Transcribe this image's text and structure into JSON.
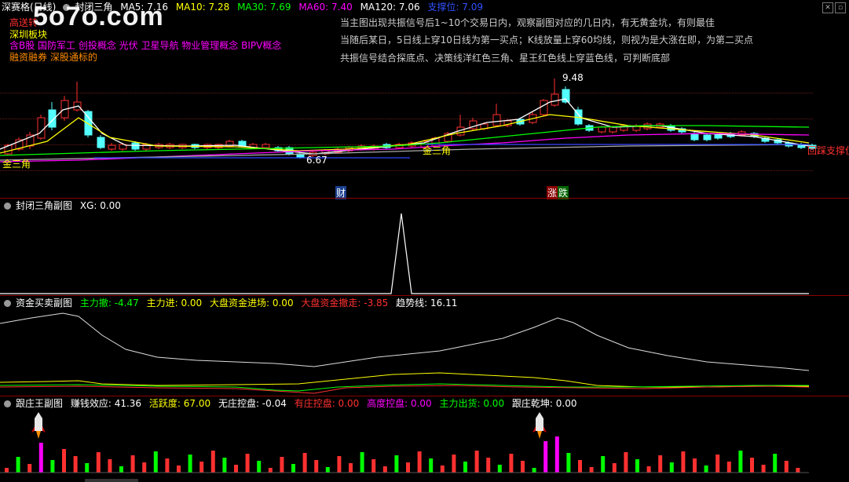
{
  "main": {
    "stock_name": "深赛格(日线)",
    "formula": "封闭三角",
    "indicators": [
      {
        "label": "MA5: 7.16",
        "color": "#ffffff"
      },
      {
        "label": "MA10: 7.28",
        "color": "#ffff00"
      },
      {
        "label": "MA30: 7.69",
        "color": "#00ff00"
      },
      {
        "label": "MA60: 7.40",
        "color": "#ff00ff"
      },
      {
        "label": "MA120: 7.06",
        "color": "#ffffff"
      },
      {
        "label": "支撑位: 7.09",
        "color": "#3050ff"
      }
    ],
    "concepts": [
      {
        "text": "高送转",
        "color": "#ff3030"
      },
      {
        "text": "深圳板块",
        "color": "#ffff00"
      },
      {
        "text": "含B股 国防军工 创投概念 光伏 卫星导航 物业管理概念 BIPV概念",
        "color": "#ff00ff"
      },
      {
        "text": "融资融券 深股通标的",
        "color": "#ff8c00"
      }
    ],
    "notes": [
      "当主图出现共振信号后1~10个交易日内，观察副图对应的几日内，有无黄金坑，有则最佳",
      "当随后某日，5日线上穿10日线为第一买点；K线放量上穿60均线，则视为是大涨在即，为第二买点",
      "共振信号结合探底点、决策线洋红色三角、星王红色线上穿蓝色线，可判断底部"
    ],
    "high_label": "9.48",
    "low_label": "6.67",
    "jin_san_jiao_1": "金三角",
    "jin_san_jiao_2": "金三角",
    "support_tag": "回踩支撑位",
    "cai_tag": "财",
    "zhang_tag": "涨",
    "die_tag": "跌",
    "watermark": "5o7o.com"
  },
  "panel2": {
    "title": "封闭三角副图",
    "xg": "XG: 0.00"
  },
  "panel3": {
    "title": "资金买卖副图",
    "items": [
      {
        "label": "主力撤: -4.47",
        "color": "#00ff00"
      },
      {
        "label": "主力进: 0.00",
        "color": "#ffff00"
      },
      {
        "label": "大盘资金进场: 0.00",
        "color": "#ffff00"
      },
      {
        "label": "大盘资金撤走: -3.85",
        "color": "#ff3030"
      },
      {
        "label": "趋势线: 16.11",
        "color": "#ffffff"
      }
    ]
  },
  "panel4": {
    "title": "跟庄王副图",
    "items": [
      {
        "label": "赚钱效应: 41.36",
        "color": "#ffffff"
      },
      {
        "label": "活跃度: 67.00",
        "color": "#ffff00"
      },
      {
        "label": "无庄控盘: -0.04",
        "color": "#ffffff"
      },
      {
        "label": "有庄控盘: 0.00",
        "color": "#ff3030"
      },
      {
        "label": "高度控盘: 0.00",
        "color": "#ff00ff"
      },
      {
        "label": "主力出货: 0.00",
        "color": "#00ff00"
      },
      {
        "label": "跟庄乾坤: 0.00",
        "color": "#ffffff"
      }
    ]
  }
}
